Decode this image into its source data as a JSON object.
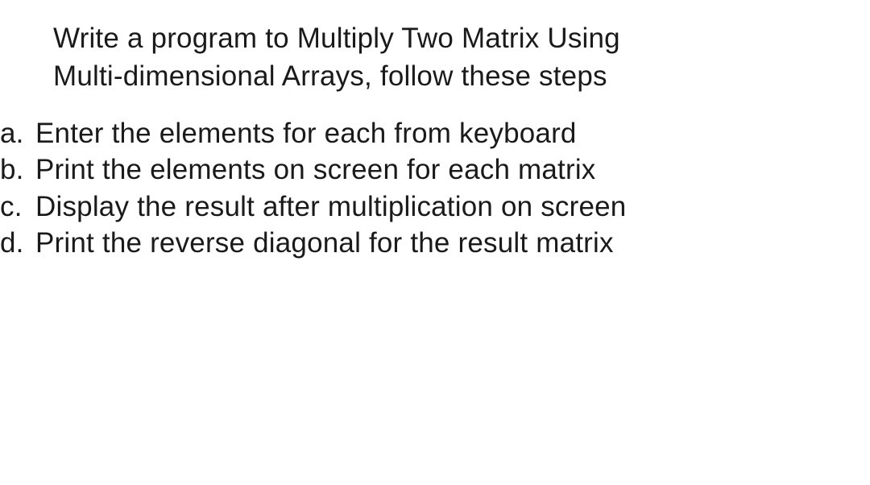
{
  "intro": {
    "line1": "Write a program to Multiply Two Matrix Using",
    "line2": "Multi-dimensional Arrays, follow these steps"
  },
  "items": [
    {
      "marker": "a.",
      "text": "Enter the elements for each from keyboard"
    },
    {
      "marker": "b.",
      "text": "Print the elements on screen for each matrix"
    },
    {
      "marker": "c.",
      "text": "Display the result after multiplication on screen"
    },
    {
      "marker": "d.",
      "text": "Print the reverse diagonal for the result matrix"
    }
  ]
}
